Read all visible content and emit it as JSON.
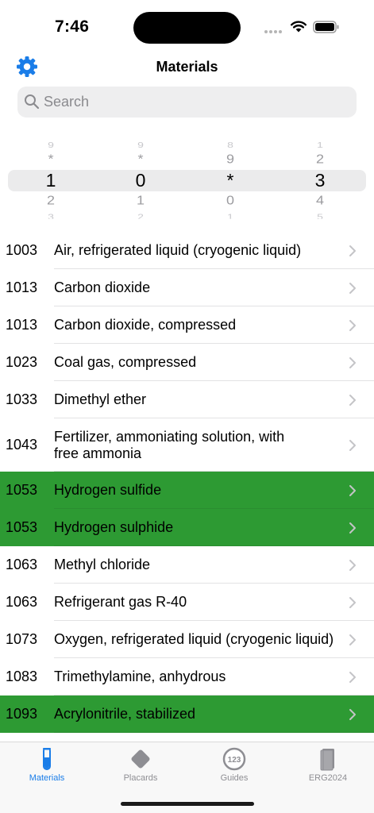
{
  "status_bar": {
    "time": "7:46"
  },
  "nav": {
    "title": "Materials"
  },
  "search": {
    "placeholder": "Search",
    "value": ""
  },
  "picker": {
    "columns": [
      {
        "far_top": "9",
        "near_top": "*",
        "selected": "1",
        "near_bottom": "2",
        "far_bottom": "3"
      },
      {
        "far_top": "9",
        "near_top": "*",
        "selected": "0",
        "near_bottom": "1",
        "far_bottom": "2"
      },
      {
        "far_top": "8",
        "near_top": "9",
        "selected": "*",
        "near_bottom": "0",
        "far_bottom": "1"
      },
      {
        "far_top": "1",
        "near_top": "2",
        "selected": "3",
        "near_bottom": "4",
        "far_bottom": "5"
      }
    ]
  },
  "materials": [
    {
      "id": "1003",
      "name": "Air, refrigerated liquid (cryogenic liquid)",
      "highlighted": false
    },
    {
      "id": "1013",
      "name": "Carbon dioxide",
      "highlighted": false
    },
    {
      "id": "1013",
      "name": "Carbon dioxide, compressed",
      "highlighted": false
    },
    {
      "id": "1023",
      "name": "Coal gas, compressed",
      "highlighted": false
    },
    {
      "id": "1033",
      "name": "Dimethyl ether",
      "highlighted": false
    },
    {
      "id": "1043",
      "name": "Fertilizer, ammoniating solution, with free ammonia",
      "highlighted": false
    },
    {
      "id": "1053",
      "name": "Hydrogen sulfide",
      "highlighted": true
    },
    {
      "id": "1053",
      "name": "Hydrogen sulphide",
      "highlighted": true
    },
    {
      "id": "1063",
      "name": "Methyl chloride",
      "highlighted": false
    },
    {
      "id": "1063",
      "name": "Refrigerant gas R-40",
      "highlighted": false
    },
    {
      "id": "1073",
      "name": "Oxygen, refrigerated liquid (cryogenic liquid)",
      "highlighted": false
    },
    {
      "id": "1083",
      "name": "Trimethylamine, anhydrous",
      "highlighted": false
    },
    {
      "id": "1093",
      "name": "Acrylonitrile, stabilized",
      "highlighted": true
    }
  ],
  "tabs": [
    {
      "label": "Materials",
      "icon": "test-tube-icon",
      "active": true
    },
    {
      "label": "Placards",
      "icon": "placard-diamond-icon",
      "active": false
    },
    {
      "label": "Guides",
      "icon": "guides-123-icon",
      "active": false
    },
    {
      "label": "ERG2024",
      "icon": "book-icon",
      "active": false
    }
  ],
  "colors": {
    "accent": "#1a7de8",
    "highlight_row": "#2d9a33",
    "inactive_tab": "#8e8e93"
  }
}
